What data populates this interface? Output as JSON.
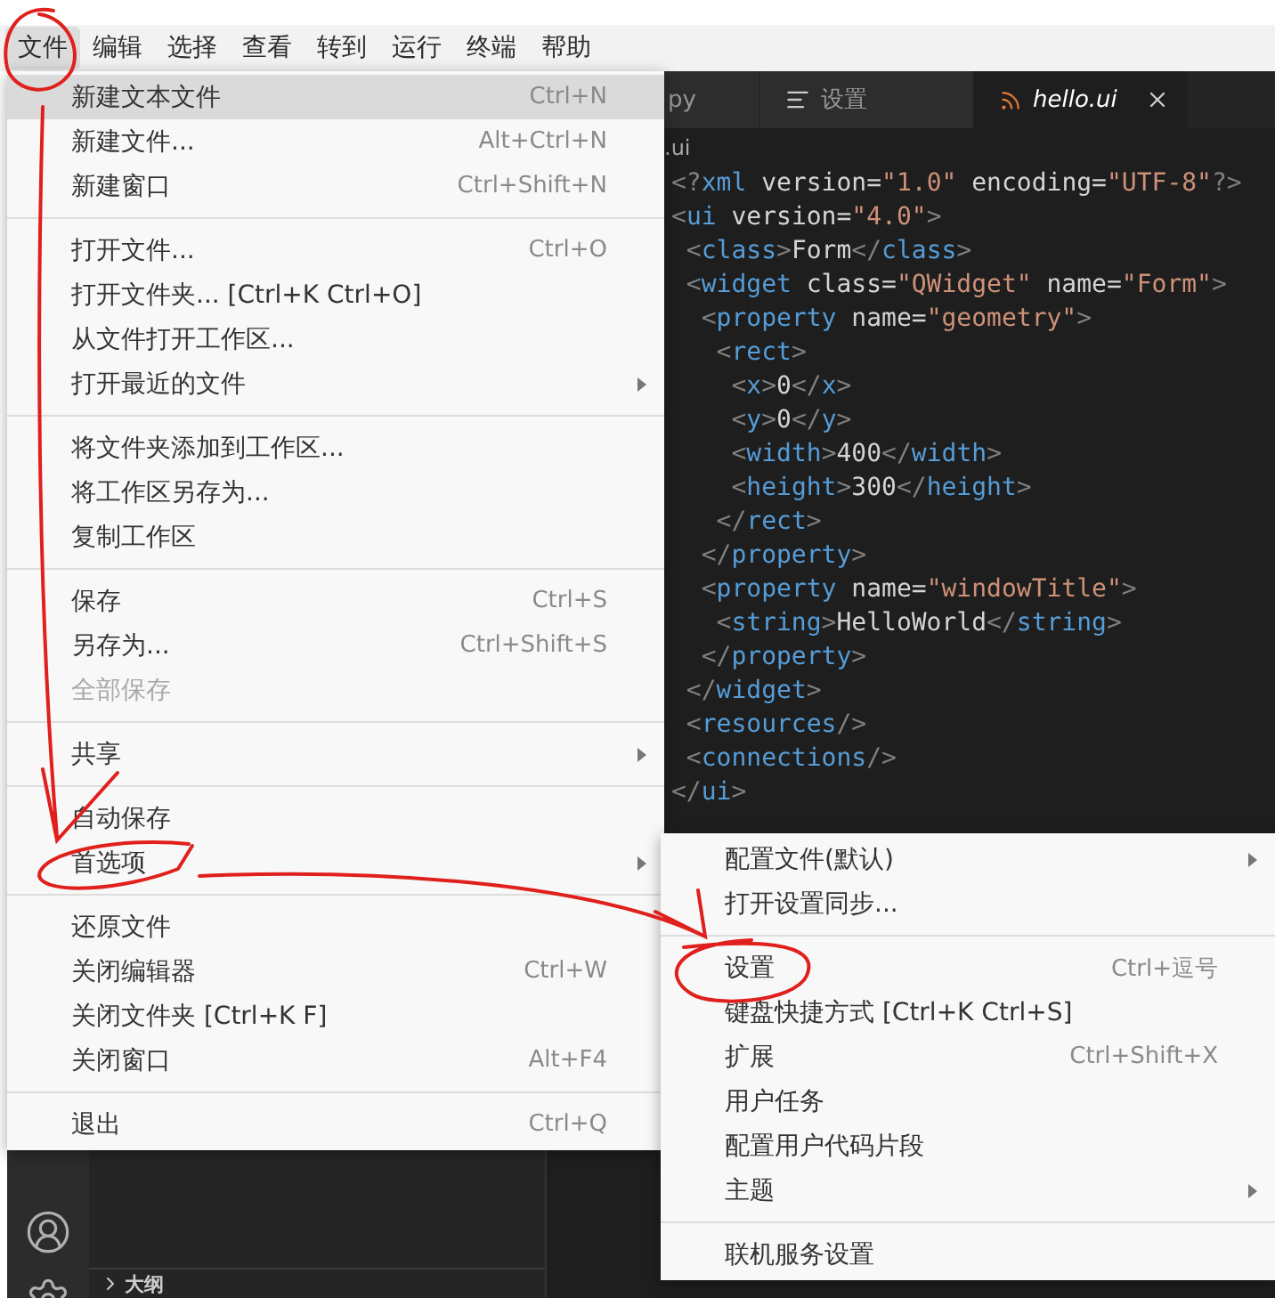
{
  "menubar": [
    {
      "label": "文件",
      "selected": true
    },
    {
      "label": "编辑",
      "selected": false
    },
    {
      "label": "选择",
      "selected": false
    },
    {
      "label": "查看",
      "selected": false
    },
    {
      "label": "转到",
      "selected": false
    },
    {
      "label": "运行",
      "selected": false
    },
    {
      "label": "终端",
      "selected": false
    },
    {
      "label": "帮助",
      "selected": false
    }
  ],
  "editor": {
    "tabs": [
      {
        "label": "py",
        "kind": "file",
        "selected": false
      },
      {
        "label": "设置",
        "kind": "settings",
        "selected": false
      },
      {
        "label": "hello.ui",
        "kind": "xml",
        "selected": true
      }
    ],
    "breadcrumb": ".ui",
    "code": [
      "<?xml version=\"1.0\" encoding=\"UTF-8\"?>",
      "<ui version=\"4.0\">",
      " <class>Form</class>",
      " <widget class=\"QWidget\" name=\"Form\">",
      "  <property name=\"geometry\">",
      "   <rect>",
      "    <x>0</x>",
      "    <y>0</y>",
      "    <width>400</width>",
      "    <height>300</height>",
      "   </rect>",
      "  </property>",
      "  <property name=\"windowTitle\">",
      "   <string>HelloWorld</string>",
      "  </property>",
      " </widget>",
      " <resources/>",
      " <connections/>",
      "</ui>"
    ]
  },
  "sidebar": {
    "section": "大纲",
    "expanded": false
  },
  "file_menu": [
    [
      {
        "label": "新建文本文件",
        "shortcut": "Ctrl+N",
        "submenu": false,
        "disabled": false,
        "selected": true
      },
      {
        "label": "新建文件...",
        "shortcut": "Alt+Ctrl+N",
        "submenu": false,
        "disabled": false,
        "selected": false
      },
      {
        "label": "新建窗口",
        "shortcut": "Ctrl+Shift+N",
        "submenu": false,
        "disabled": false,
        "selected": false
      }
    ],
    [
      {
        "label": "打开文件...",
        "shortcut": "Ctrl+O",
        "submenu": false,
        "disabled": false,
        "selected": false
      },
      {
        "label": "打开文件夹... [Ctrl+K Ctrl+O]",
        "submenu": false,
        "disabled": false,
        "selected": false
      },
      {
        "label": "从文件打开工作区...",
        "submenu": false,
        "disabled": false,
        "selected": false
      },
      {
        "label": "打开最近的文件",
        "submenu": true,
        "disabled": false,
        "selected": false
      }
    ],
    [
      {
        "label": "将文件夹添加到工作区...",
        "submenu": false,
        "disabled": false,
        "selected": false
      },
      {
        "label": "将工作区另存为...",
        "submenu": false,
        "disabled": false,
        "selected": false
      },
      {
        "label": "复制工作区",
        "submenu": false,
        "disabled": false,
        "selected": false
      }
    ],
    [
      {
        "label": "保存",
        "shortcut": "Ctrl+S",
        "submenu": false,
        "disabled": false,
        "selected": false
      },
      {
        "label": "另存为...",
        "shortcut": "Ctrl+Shift+S",
        "submenu": false,
        "disabled": false,
        "selected": false
      },
      {
        "label": "全部保存",
        "submenu": false,
        "disabled": true,
        "selected": false
      }
    ],
    [
      {
        "label": "共享",
        "submenu": true,
        "disabled": false,
        "selected": false
      }
    ],
    [
      {
        "label": "自动保存",
        "submenu": false,
        "disabled": false,
        "selected": false
      },
      {
        "label": "首选项",
        "submenu": true,
        "disabled": false,
        "selected": false
      }
    ],
    [
      {
        "label": "还原文件",
        "submenu": false,
        "disabled": false,
        "selected": false
      },
      {
        "label": "关闭编辑器",
        "shortcut": "Ctrl+W",
        "submenu": false,
        "disabled": false,
        "selected": false
      },
      {
        "label": "关闭文件夹 [Ctrl+K F]",
        "submenu": false,
        "disabled": false,
        "selected": false
      },
      {
        "label": "关闭窗口",
        "shortcut": "Alt+F4",
        "submenu": false,
        "disabled": false,
        "selected": false
      }
    ],
    [
      {
        "label": "退出",
        "shortcut": "Ctrl+Q",
        "submenu": false,
        "disabled": false,
        "selected": false
      }
    ]
  ],
  "preferences_menu": [
    [
      {
        "label": "配置文件(默认)",
        "submenu": true,
        "disabled": false,
        "selected": false
      },
      {
        "label": "打开设置同步...",
        "submenu": false,
        "disabled": false,
        "selected": false
      }
    ],
    [
      {
        "label": "设置",
        "shortcut": "Ctrl+逗号",
        "submenu": false,
        "disabled": false,
        "selected": false
      },
      {
        "label": "键盘快捷方式 [Ctrl+K Ctrl+S]",
        "submenu": false,
        "disabled": false,
        "selected": false
      },
      {
        "label": "扩展",
        "shortcut": "Ctrl+Shift+X",
        "submenu": false,
        "disabled": false,
        "selected": false
      },
      {
        "label": "用户任务",
        "submenu": false,
        "disabled": false,
        "selected": false
      },
      {
        "label": "配置用户代码片段",
        "submenu": false,
        "disabled": false,
        "selected": false
      },
      {
        "label": "主题",
        "submenu": true,
        "disabled": false,
        "selected": false
      }
    ],
    [
      {
        "label": "联机服务设置",
        "submenu": false,
        "disabled": false,
        "selected": false
      }
    ]
  ]
}
